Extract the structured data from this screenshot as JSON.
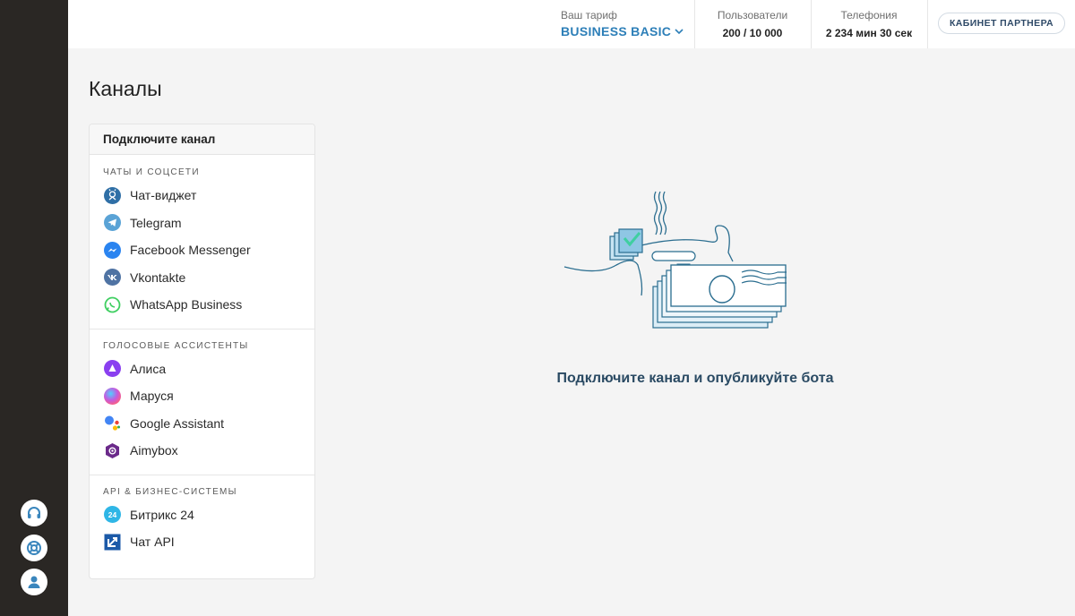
{
  "topbar": {
    "tariff_label": "Ваш тариф",
    "tariff_value": "BUSINESS BASIC",
    "users_label": "Пользователи",
    "users_value": "200 / 10 000",
    "telephony_label": "Телефония",
    "telephony_value": "2 234 мин 30 сек",
    "partner_button": "КАБИНЕТ ПАРТНЕРА",
    "accent_color": "#2d7fb8"
  },
  "page": {
    "title": "Каналы"
  },
  "panel": {
    "header": "Подключите канал",
    "groups": [
      {
        "title": "ЧАТЫ И СОЦСЕТИ",
        "items": [
          {
            "label": "Чат-виджет",
            "icon": "chat-widget-icon",
            "color": "#2f6fa6"
          },
          {
            "label": "Telegram",
            "icon": "telegram-icon",
            "color": "#5aa3d6"
          },
          {
            "label": "Facebook Messenger",
            "icon": "messenger-icon",
            "color": "#2a84f0"
          },
          {
            "label": "Vkontakte",
            "icon": "vk-icon",
            "color": "#4f73a3"
          },
          {
            "label": "WhatsApp Business",
            "icon": "whatsapp-icon",
            "color": "#3fcf61"
          }
        ]
      },
      {
        "title": "ГОЛОСОВЫЕ АССИСТЕНТЫ",
        "items": [
          {
            "label": "Алиса",
            "icon": "alice-icon",
            "color": "#8a3ff0"
          },
          {
            "label": "Маруся",
            "icon": "marusya-icon",
            "color": "#c45adf"
          },
          {
            "label": "Google Assistant",
            "icon": "google-assistant-icon",
            "color": "#4285f4"
          },
          {
            "label": "Aimybox",
            "icon": "aimybox-icon",
            "color": "#6b2a8a"
          }
        ]
      },
      {
        "title": "API & БИЗНЕС-СИСТЕМЫ",
        "items": [
          {
            "label": "Битрикс 24",
            "icon": "bitrix24-icon",
            "color": "#2fb6e6",
            "badge": "24"
          },
          {
            "label": "Чат API",
            "icon": "chat-api-icon",
            "color": "#1c5aa8"
          }
        ]
      }
    ]
  },
  "empty_state": {
    "message": "Подключите канал и опубликуйте бота"
  }
}
